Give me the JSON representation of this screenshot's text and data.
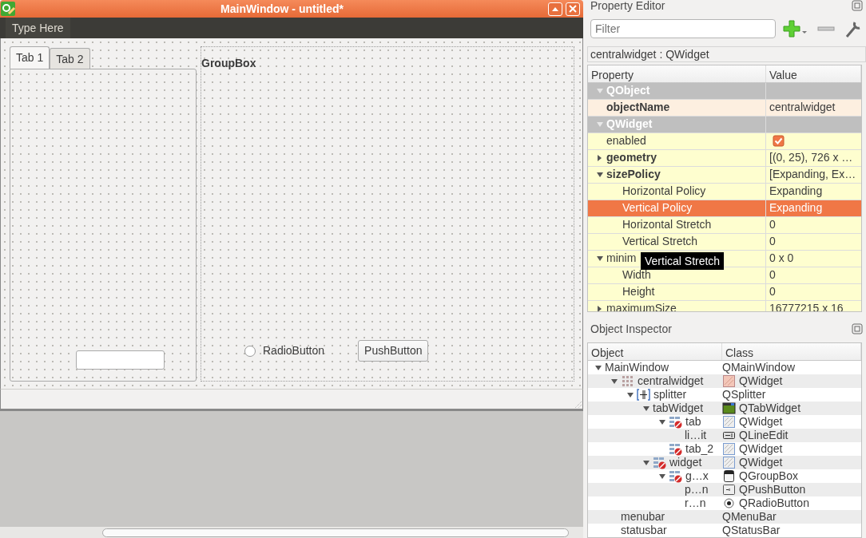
{
  "window": {
    "title": "MainWindow - untitled*",
    "menu_placeholder": "Type Here"
  },
  "form": {
    "tabs": [
      {
        "label": "Tab 1",
        "selected": true
      },
      {
        "label": "Tab 2",
        "selected": false
      }
    ],
    "groupbox": {
      "title": "GroupBox",
      "radio": {
        "label": "RadioButton",
        "checked": false
      },
      "button": "PushButton"
    }
  },
  "property_editor": {
    "title": "Property Editor",
    "filter_placeholder": "Filter",
    "object_label": "centralwidget : QWidget",
    "columns": [
      "Property",
      "Value"
    ],
    "rows": [
      {
        "kind": "category",
        "name": "QObject",
        "expanded": true,
        "children": [
          {
            "kind": "text",
            "name": "objectName",
            "value": "centralwidget",
            "modified": true,
            "selected": false
          }
        ]
      },
      {
        "kind": "category",
        "name": "QWidget",
        "expanded": true,
        "children": [
          {
            "kind": "checkbox",
            "name": "enabled",
            "checked": true,
            "modified": false,
            "selected": false
          },
          {
            "kind": "text",
            "name": "geometry",
            "value": "[(0, 25), 726 x …",
            "modified": true,
            "expanded": false,
            "selected": false
          },
          {
            "kind": "text",
            "name": "sizePolicy",
            "value": "[Expanding, Ex…",
            "modified": true,
            "expanded": true,
            "selected": false,
            "children": [
              {
                "kind": "text",
                "name": "Horizontal Policy",
                "value": "Expanding",
                "modified": false,
                "selected": false
              },
              {
                "kind": "text",
                "name": "Vertical Policy",
                "value": "Expanding",
                "modified": false,
                "selected": true
              },
              {
                "kind": "text",
                "name": "Horizontal Stretch",
                "value": "0",
                "modified": false,
                "selected": false
              },
              {
                "kind": "text",
                "name": "Vertical Stretch",
                "value": "0",
                "modified": false,
                "selected": false
              }
            ]
          },
          {
            "kind": "text",
            "name": "minim",
            "value": "0 x 0",
            "modified": false,
            "expanded": true,
            "selected": false,
            "children": [
              {
                "kind": "text",
                "name": "Width",
                "value": "0",
                "modified": false,
                "selected": false
              },
              {
                "kind": "text",
                "name": "Height",
                "value": "0",
                "modified": false,
                "selected": false
              }
            ]
          },
          {
            "kind": "text",
            "name": "maximumSize",
            "value": "16777215 x 16",
            "modified": false,
            "expanded": false,
            "selected": false
          }
        ]
      }
    ],
    "tooltip": "Vertical Stretch"
  },
  "object_inspector": {
    "title": "Object Inspector",
    "columns": [
      "Object",
      "Class"
    ],
    "tree": [
      {
        "object": "MainWindow",
        "class": "QMainWindow",
        "expanded": true,
        "children": [
          {
            "object": "centralwidget",
            "class": "QWidget",
            "kind": "central",
            "expanded": true,
            "children": [
              {
                "object": "splitter",
                "class": "QSplitter",
                "kind": "splitter",
                "expanded": true,
                "children": [
                  {
                    "object": "tabWidget",
                    "class": "QTabWidget",
                    "kind": "tabwidget",
                    "expanded": true,
                    "children": [
                      {
                        "object": "tab",
                        "class": "QWidget",
                        "kind": "container",
                        "expanded": true,
                        "children": [
                          {
                            "object": "li…it",
                            "class": "QLineEdit",
                            "kind": "lineedit"
                          }
                        ]
                      },
                      {
                        "object": "tab_2",
                        "class": "QWidget",
                        "kind": "container"
                      }
                    ]
                  },
                  {
                    "object": "widget",
                    "class": "QWidget",
                    "kind": "container",
                    "expanded": true,
                    "children": [
                      {
                        "object": "g…x",
                        "class": "QGroupBox",
                        "kind": "groupbox",
                        "expanded": true,
                        "children": [
                          {
                            "object": "p…n",
                            "class": "QPushButton",
                            "kind": "pushbutton"
                          },
                          {
                            "object": "r…n",
                            "class": "QRadioButton",
                            "kind": "radiobutton"
                          }
                        ]
                      }
                    ]
                  }
                ]
              }
            ]
          },
          {
            "object": "menubar",
            "class": "QMenuBar"
          },
          {
            "object": "statusbar",
            "class": "QStatusBar"
          }
        ]
      }
    ]
  }
}
